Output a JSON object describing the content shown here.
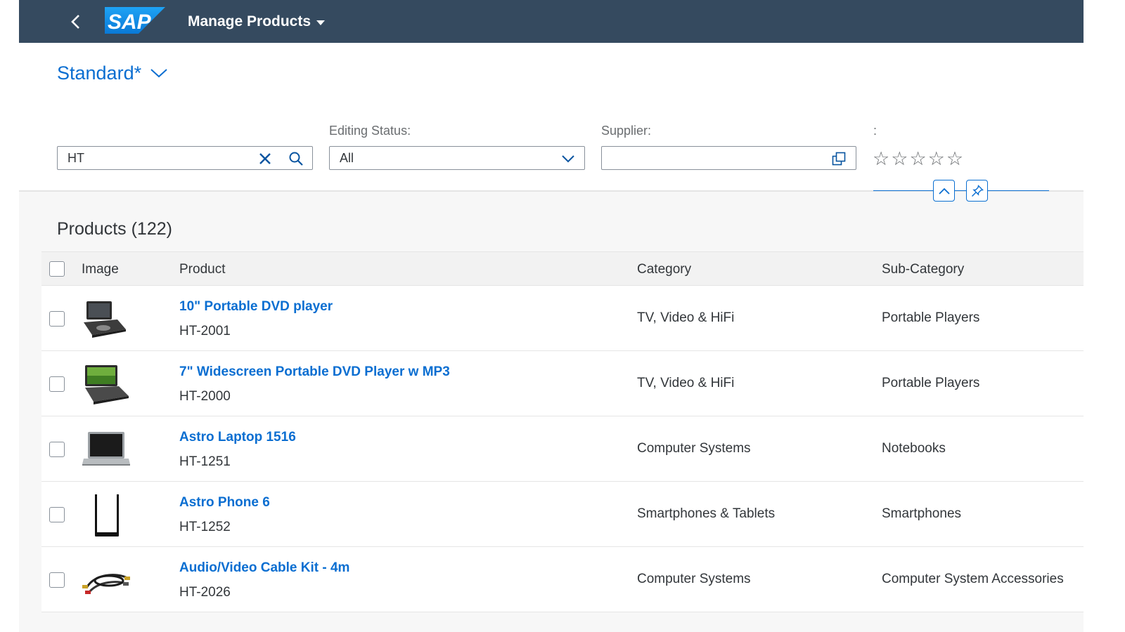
{
  "shell": {
    "logo_text": "SAP",
    "app_title": "Manage Products"
  },
  "variant": {
    "name": "Standard*"
  },
  "filters": {
    "search": {
      "value": "HT"
    },
    "editing_status": {
      "label": "Editing Status:",
      "value": "All"
    },
    "supplier": {
      "label": "Supplier:",
      "value": ""
    },
    "rating": {
      "label": ":",
      "stars": [
        "☆",
        "☆",
        "☆",
        "☆",
        "☆"
      ]
    }
  },
  "table": {
    "title": "Products (122)",
    "columns": [
      "Image",
      "Product",
      "Category",
      "Sub-Category"
    ],
    "rows": [
      {
        "name": "10\" Portable DVD player",
        "id": "HT-2001",
        "category": "TV, Video & HiFi",
        "subcategory": "Portable Players",
        "image": "portable-dvd-player-image"
      },
      {
        "name": "7\" Widescreen Portable DVD Player w MP3",
        "id": "HT-2000",
        "category": "TV, Video & HiFi",
        "subcategory": "Portable Players",
        "image": "widescreen-dvd-player-image"
      },
      {
        "name": "Astro Laptop 1516",
        "id": "HT-1251",
        "category": "Computer Systems",
        "subcategory": "Notebooks",
        "image": "laptop-image"
      },
      {
        "name": "Astro Phone 6",
        "id": "HT-1252",
        "category": "Smartphones & Tablets",
        "subcategory": "Smartphones",
        "image": "smartphone-image"
      },
      {
        "name": "Audio/Video Cable Kit - 4m",
        "id": "HT-2026",
        "category": "Computer Systems",
        "subcategory": "Computer System Accessories",
        "image": "cable-kit-image"
      }
    ]
  },
  "colors": {
    "shell_bg": "#354a5f",
    "link_blue": "#0a6ed1",
    "sap_logo_blue": "#0f9ef3"
  }
}
